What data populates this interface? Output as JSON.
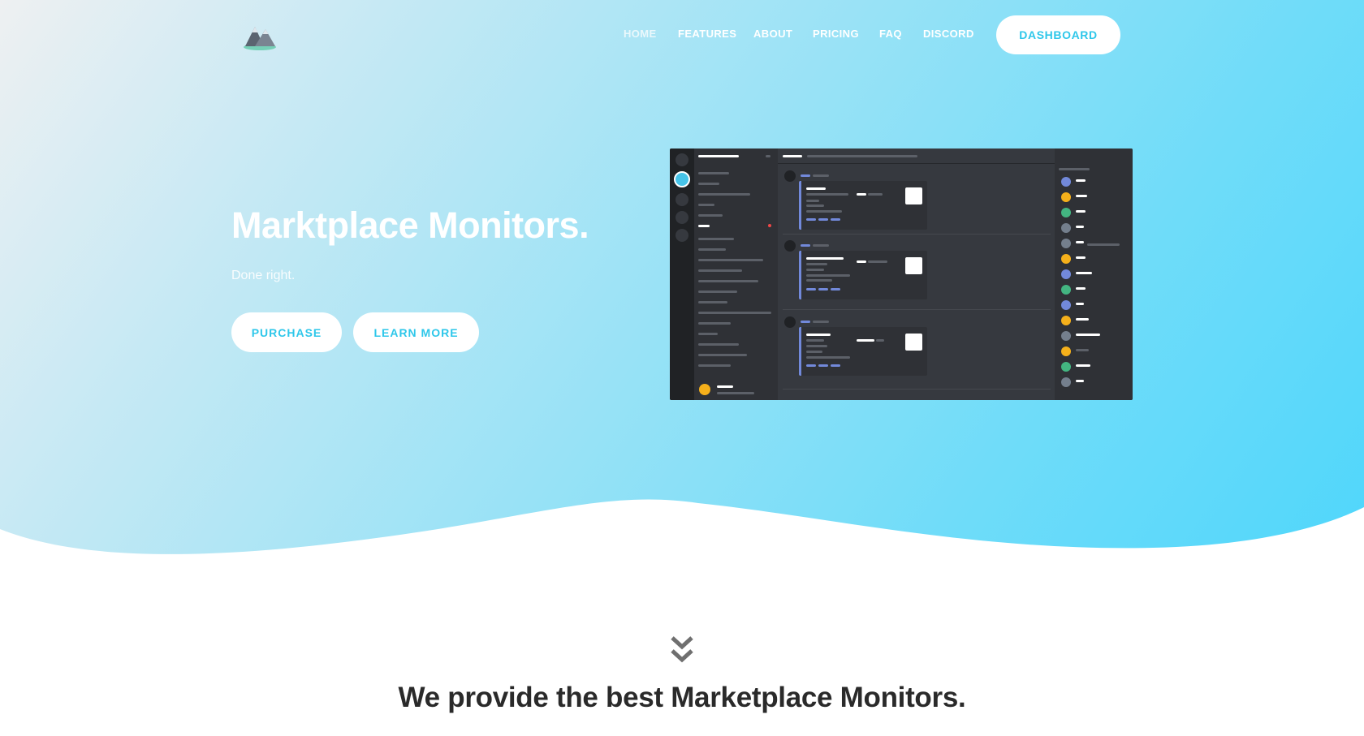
{
  "nav": {
    "logo": "mountain-logo",
    "links": [
      "HOME",
      "FEATURES",
      "ABOUT",
      "PRICING",
      "FAQ",
      "DISCORD"
    ],
    "active": "HOME",
    "dashboard_label": "DASHBOARD"
  },
  "hero": {
    "title": "Marktplace Monitors.",
    "subtitle": "Done right.",
    "purchase_label": "PURCHASE",
    "learn_more_label": "LEARN MORE",
    "screenshot": "discord-monitor-preview"
  },
  "section": {
    "icon": "double-chevron-down-icon",
    "title": "We provide the best Marketplace Monitors."
  },
  "colors": {
    "accent": "#2ec7ea",
    "gradient_start": "#eef0f2",
    "gradient_end": "#4fd6fb",
    "heading_dark": "#2a2a2a"
  }
}
